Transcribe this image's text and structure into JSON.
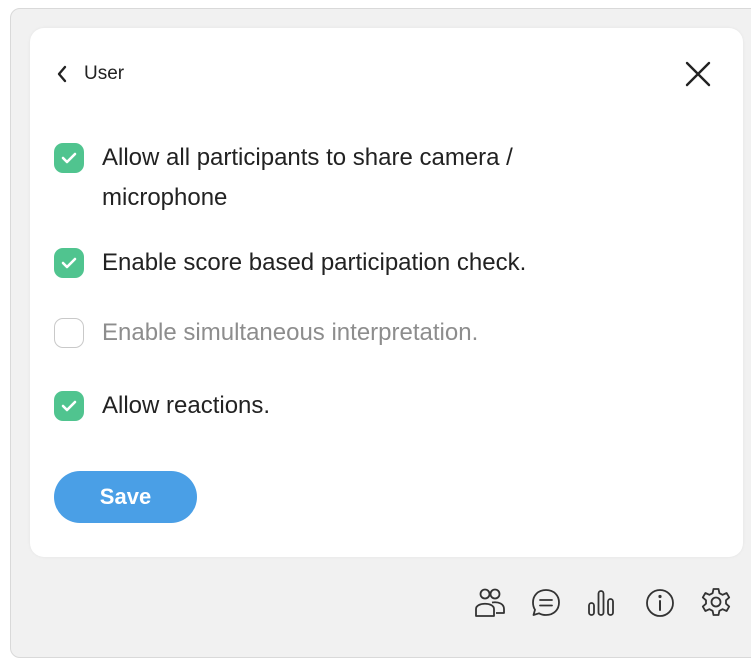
{
  "header": {
    "back_label": "User"
  },
  "options": [
    {
      "label": "Allow all participants to share camera / microphone",
      "checked": true
    },
    {
      "label": "Enable score based participation check.",
      "checked": true
    },
    {
      "label": "Enable simultaneous interpretation.",
      "checked": false
    },
    {
      "label": "Allow reactions.",
      "checked": true
    }
  ],
  "save_label": "Save",
  "colors": {
    "checked": "#50c48f",
    "save": "#4a9fe6"
  },
  "toolbar": {
    "icons": [
      "participants-icon",
      "chat-icon",
      "poll-chart-icon",
      "info-icon",
      "settings-gear-icon"
    ]
  }
}
